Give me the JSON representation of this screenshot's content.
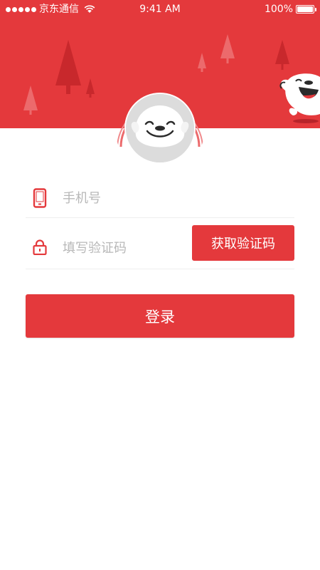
{
  "status_bar": {
    "carrier": "京东通信",
    "time": "9:41 AM",
    "battery": "100%",
    "signal_icon": "signal-dots-icon",
    "wifi_icon": "wifi-icon",
    "battery_icon": "battery-icon"
  },
  "header": {
    "background_color": "#e4393c",
    "mascot": "joy-dog-mascot"
  },
  "avatar": {
    "icon": "joy-dog-face-avatar"
  },
  "login_form": {
    "phone": {
      "icon": "mobile-phone-icon",
      "placeholder": "手机号",
      "value": ""
    },
    "code": {
      "icon": "lock-icon",
      "placeholder": "填写验证码",
      "value": ""
    },
    "get_code_label": "获取验证码",
    "login_label": "登录"
  },
  "colors": {
    "accent": "#e4393c",
    "placeholder": "#b8b8b8",
    "divider": "#eeeeee"
  }
}
